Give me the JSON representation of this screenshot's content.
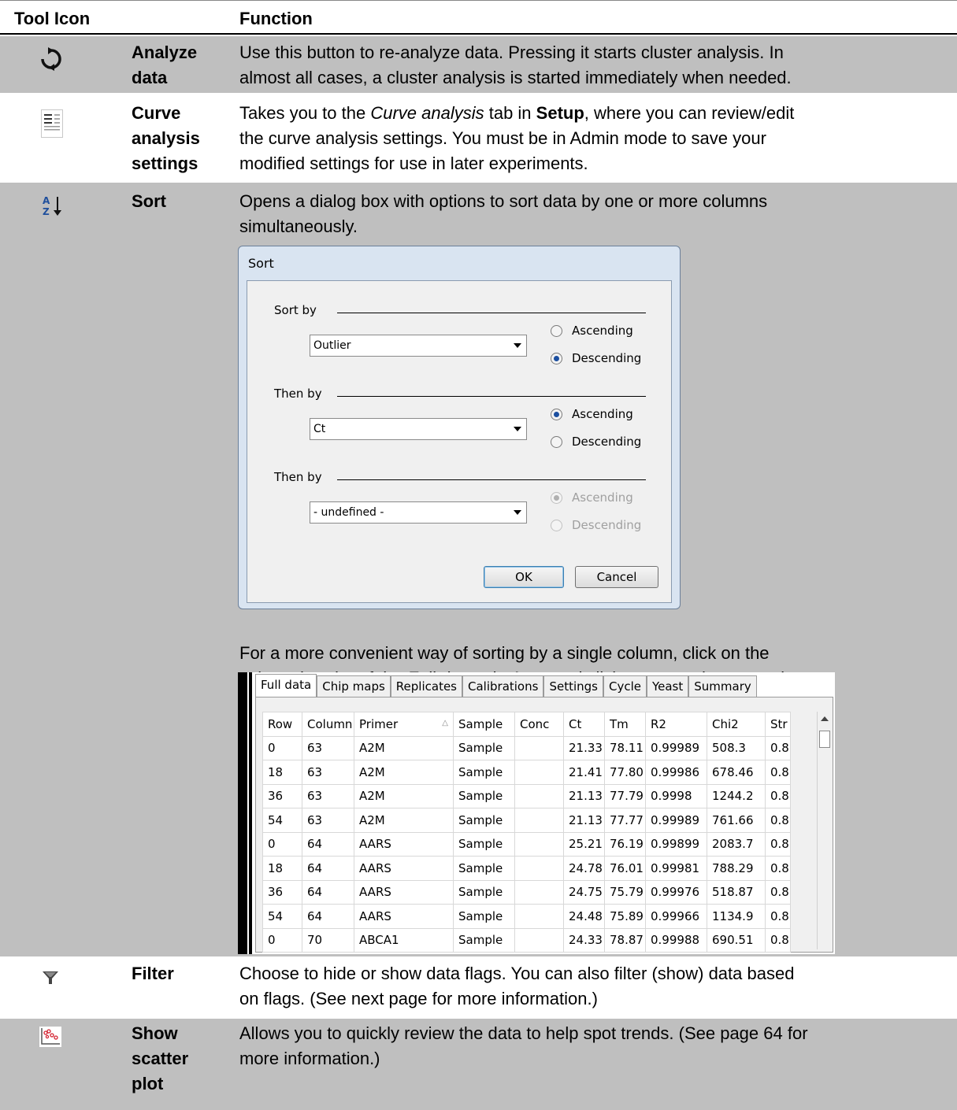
{
  "header": {
    "col1": "Tool Icon",
    "col2": "Function"
  },
  "rows": [
    {
      "name": [
        "Analyze",
        "data"
      ],
      "icon": "refresh-icon",
      "desc": [
        "Use this button to re-analyze data. Pressing it starts cluster analysis. In",
        "almost all cases, a cluster analysis is started immediately when needed."
      ]
    },
    {
      "name": [
        "Curve",
        "analysis",
        "settings"
      ],
      "icon": "curve-settings-icon",
      "desc_parts": {
        "l1a": "Takes you to the ",
        "l1b": "Curve analysis",
        "l1c": " tab in ",
        "l1d": "Setup",
        "l1e": ", where you can review/edit",
        "l2": "the curve analysis settings. You must be in Admin mode to save your",
        "l3": "modified settings for use in later experiments."
      }
    },
    {
      "name": [
        "Sort"
      ],
      "icon": "sort-az-icon",
      "desc": [
        "Opens a dialog box with options to sort data by one or more columns",
        "simultaneously."
      ],
      "after": {
        "l1": "For a more convenient way of sorting by a single column, click on the",
        "l2a": "column header of the ",
        "l2b": "Full data",
        "l2c": " tab. A second click reverses the sort order."
      }
    },
    {
      "name": [
        "Filter"
      ],
      "icon": "filter-icon",
      "desc": [
        "Choose to hide or show data flags. You can also filter (show) data based",
        "on flags. (See next page for more information.)"
      ]
    },
    {
      "name": [
        "Show",
        "scatter",
        "plot"
      ],
      "icon": "scatter-plot-icon",
      "desc": [
        "Allows you to quickly review the data to help spot trends. (See page 64 for",
        "more information.)"
      ]
    }
  ],
  "sort_dialog": {
    "title": "Sort",
    "groups": [
      {
        "label": "Sort by",
        "value": "Outlier",
        "asc": "Ascending",
        "desc": "Descending",
        "selected": "desc",
        "enabled": true
      },
      {
        "label": "Then by",
        "value": "Ct",
        "asc": "Ascending",
        "desc": "Descending",
        "selected": "asc",
        "enabled": true
      },
      {
        "label": "Then by",
        "value": "- undefined -",
        "asc": "Ascending",
        "desc": "Descending",
        "selected": "asc",
        "enabled": false
      }
    ],
    "ok": "OK",
    "cancel": "Cancel"
  },
  "full_data": {
    "tabs": [
      "Full data",
      "Chip maps",
      "Replicates",
      "Calibrations",
      "Settings",
      "Cycle",
      "Yeast",
      "Summary"
    ],
    "columns": [
      "Row",
      "Column",
      "Primer",
      "Sample",
      "Conc",
      "Ct",
      "Tm",
      "R2",
      "Chi2",
      "Str"
    ],
    "rows": [
      [
        "0",
        "63",
        "A2M",
        "Sample",
        "",
        "21.33",
        "78.11",
        "0.99989",
        "508.3",
        "0.8"
      ],
      [
        "18",
        "63",
        "A2M",
        "Sample",
        "",
        "21.41",
        "77.80",
        "0.99986",
        "678.46",
        "0.8"
      ],
      [
        "36",
        "63",
        "A2M",
        "Sample",
        "",
        "21.13",
        "77.79",
        "0.9998",
        "1244.2",
        "0.8"
      ],
      [
        "54",
        "63",
        "A2M",
        "Sample",
        "",
        "21.13",
        "77.77",
        "0.99989",
        "761.66",
        "0.8"
      ],
      [
        "0",
        "64",
        "AARS",
        "Sample",
        "",
        "25.21",
        "76.19",
        "0.99899",
        "2083.7",
        "0.8"
      ],
      [
        "18",
        "64",
        "AARS",
        "Sample",
        "",
        "24.78",
        "76.01",
        "0.99981",
        "788.29",
        "0.8"
      ],
      [
        "36",
        "64",
        "AARS",
        "Sample",
        "",
        "24.75",
        "75.79",
        "0.99976",
        "518.87",
        "0.8"
      ],
      [
        "54",
        "64",
        "AARS",
        "Sample",
        "",
        "24.48",
        "75.89",
        "0.99966",
        "1134.9",
        "0.8"
      ],
      [
        "0",
        "70",
        "ABCA1",
        "Sample",
        "",
        "24.33",
        "78.87",
        "0.99988",
        "690.51",
        "0.8"
      ]
    ]
  }
}
